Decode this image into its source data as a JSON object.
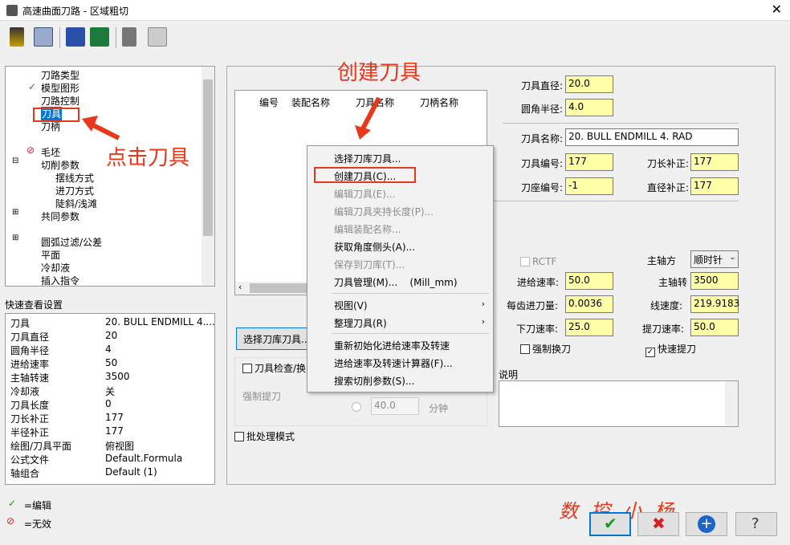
{
  "window": {
    "title": "高速曲面刀路 - 区域粗切"
  },
  "tree": {
    "items": [
      "刀路类型",
      "模型图形",
      "刀路控制",
      "刀具",
      "刀柄",
      "毛坯",
      "切削参数",
      "摆线方式",
      "进刀方式",
      "陡斜/浅滩",
      "共同参数",
      "圆弧过滤/公差",
      "平面",
      "冷却液",
      "插入指令"
    ]
  },
  "quickview": {
    "title": "快速查看设置",
    "rows": [
      {
        "k": "刀具",
        "v": "20. BULL ENDMILL 4...."
      },
      {
        "k": "刀具直径",
        "v": "20"
      },
      {
        "k": "圆角半径",
        "v": "4"
      },
      {
        "k": "进给速率",
        "v": "50"
      },
      {
        "k": "主轴转速",
        "v": "3500"
      },
      {
        "k": "冷却液",
        "v": "关"
      },
      {
        "k": "刀具长度",
        "v": "0"
      },
      {
        "k": "刀长补正",
        "v": "177"
      },
      {
        "k": "半径补正",
        "v": "177"
      },
      {
        "k": "绘图/刀具平面",
        "v": "俯视图"
      },
      {
        "k": "公式文件",
        "v": "Default.Formula"
      },
      {
        "k": "轴组合",
        "v": "Default (1)"
      }
    ]
  },
  "legend": {
    "edit": "=编辑",
    "invalid": "=无效"
  },
  "tool_table": {
    "columns": [
      "编号",
      "装配名称",
      "刀具名称",
      "刀柄名称"
    ]
  },
  "context_menu": {
    "items": [
      {
        "label": "选择刀库刀具...",
        "enabled": true
      },
      {
        "label": "创建刀具(C)...",
        "enabled": true
      },
      {
        "label": "编辑刀具(E)...",
        "enabled": false
      },
      {
        "label": "编辑刀具夹持长度(P)...",
        "enabled": false
      },
      {
        "label": "编辑装配名称...",
        "enabled": false
      },
      {
        "label": "获取角度侧头(A)...",
        "enabled": true
      },
      {
        "label": "保存到刀库(T)...",
        "enabled": false
      },
      {
        "label": "刀具管理(M)...    (Mill_mm)",
        "enabled": true
      },
      {
        "label": "视图(V)",
        "enabled": true
      },
      {
        "label": "整理刀具(R)",
        "enabled": true
      },
      {
        "label": "重新初始化进给速率及转速",
        "enabled": true
      },
      {
        "label": "进给速率及转速计算器(F)...",
        "enabled": true
      },
      {
        "label": "搜索切削参数(S)...",
        "enabled": true
      }
    ]
  },
  "annotations": {
    "create_tool": "创建刀具",
    "click_tool": "点击刀具",
    "watermark": "数 控 小 杨"
  },
  "params": {
    "tool_diameter_label": "刀具直径:",
    "tool_diameter": "20.0",
    "corner_radius_label": "圆角半径:",
    "corner_radius": "4.0",
    "tool_name_label": "刀具名称:",
    "tool_name": "20. BULL ENDMILL 4. RAD",
    "tool_number_label": "刀具编号:",
    "tool_number": "177",
    "length_comp_label": "刀长补正:",
    "length_comp": "177",
    "head_number_label": "刀座编号:",
    "head_number": "-1",
    "dia_comp_label": "直径补正:",
    "dia_comp": "177",
    "rctf_label": "RCTF",
    "spindle_dir_label": "主轴方",
    "spindle_dir": "顺时针",
    "feed_rate_label": "进给速率:",
    "feed_rate": "50.0",
    "spindle_speed_label": "主轴转",
    "spindle_speed": "3500",
    "feed_per_tooth_label": "每齿进刀量:",
    "feed_per_tooth": "0.0036",
    "surface_speed_label": "线速度:",
    "surface_speed": "219.9183",
    "plunge_rate_label": "下刀速率:",
    "plunge_rate": "25.0",
    "retract_rate_label": "提刀速率:",
    "retract_rate": "50.0",
    "force_tool_change": "强制换刀",
    "rapid_retract": "快速提刀",
    "comment_label": "说明",
    "select_lib_button": "选择刀库刀具...",
    "tool_check_label": "刀具检查/换",
    "force_retract": "强制提刀",
    "minutes_value": "40.0",
    "minutes_label": "分钟",
    "batch_mode": "批处理模式"
  },
  "colors": {
    "accent_red": "#e8381c",
    "yellow_field": "#ffffa8"
  }
}
